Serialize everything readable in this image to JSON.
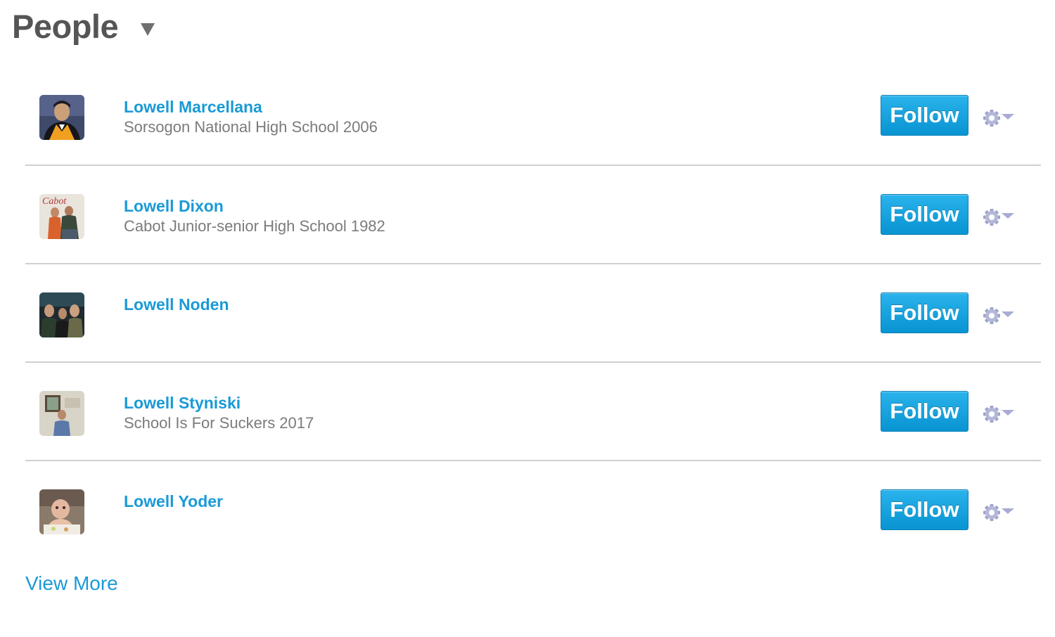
{
  "header": {
    "title": "People"
  },
  "people": [
    {
      "name": "Lowell Marcellana",
      "school": "Sorsogon National High School 2006",
      "follow_label": "Follow",
      "avatar": "graduation-photo-avatar"
    },
    {
      "name": "Lowell Dixon",
      "school": "Cabot Junior-senior High School 1982",
      "follow_label": "Follow",
      "avatar": "group-photo-avatar"
    },
    {
      "name": "Lowell Noden",
      "school": "",
      "follow_label": "Follow",
      "avatar": "three-men-photo-avatar"
    },
    {
      "name": "Lowell Styniski",
      "school": "School Is For Suckers 2017",
      "follow_label": "Follow",
      "avatar": "indoor-portrait-avatar"
    },
    {
      "name": "Lowell Yoder",
      "school": "",
      "follow_label": "Follow",
      "avatar": "baby-photo-avatar"
    }
  ],
  "footer": {
    "view_more_label": "View More"
  },
  "colors": {
    "link": "#1a9ad6",
    "title": "#555555",
    "subtext": "#7b7b7b",
    "button": "#0894d2",
    "divider": "#d0d0d0"
  }
}
